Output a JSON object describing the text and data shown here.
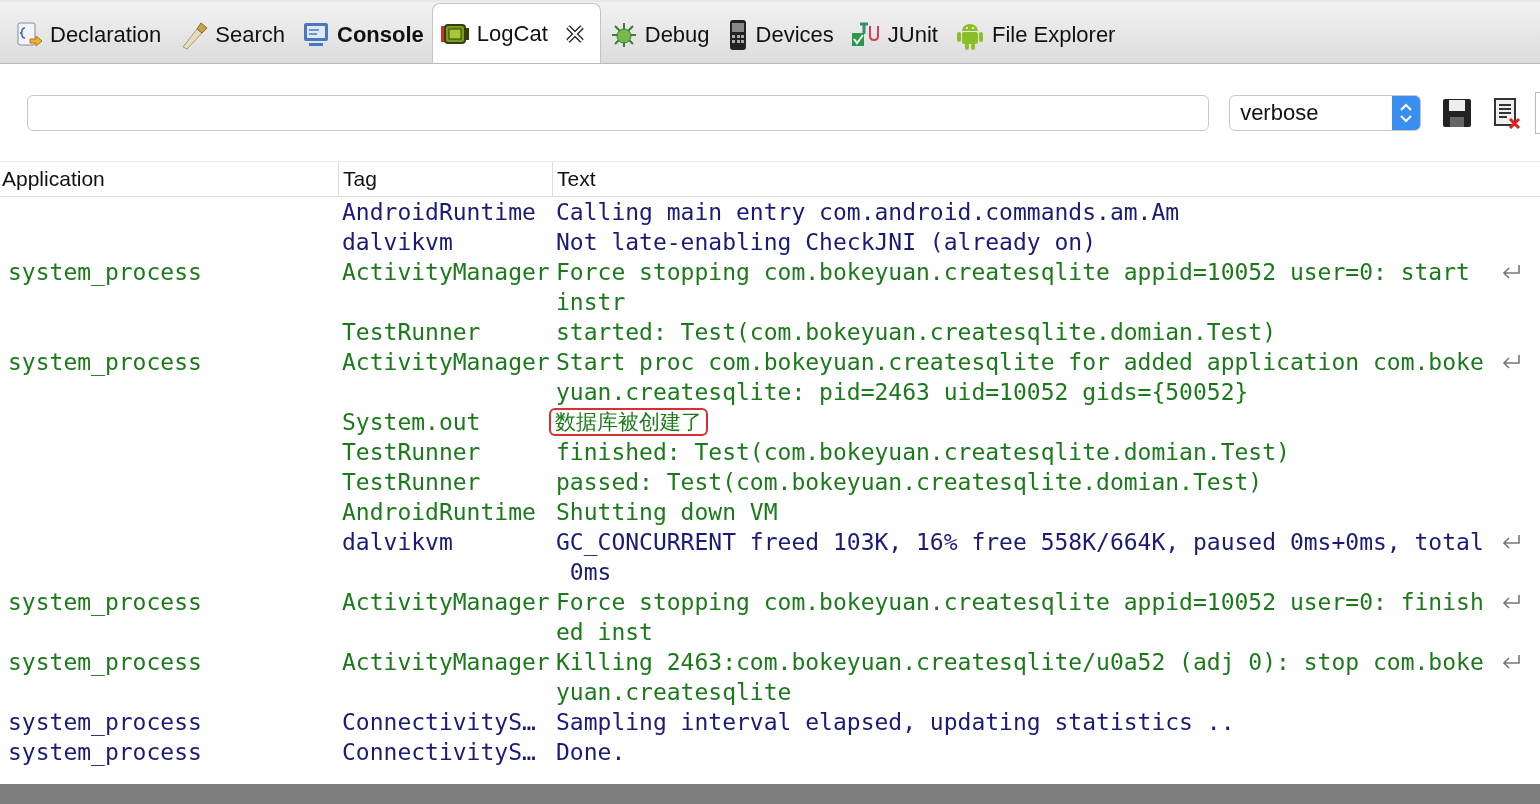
{
  "tabs": [
    {
      "label": "Declaration",
      "selected": false,
      "bold": false,
      "closable": false
    },
    {
      "label": "Search",
      "selected": false,
      "bold": false,
      "closable": false
    },
    {
      "label": "Console",
      "selected": false,
      "bold": true,
      "closable": false
    },
    {
      "label": "LogCat",
      "selected": true,
      "bold": false,
      "closable": true
    },
    {
      "label": "Debug",
      "selected": false,
      "bold": false,
      "closable": false
    },
    {
      "label": "Devices",
      "selected": false,
      "bold": false,
      "closable": false
    },
    {
      "label": "JUnit",
      "selected": false,
      "bold": false,
      "closable": false
    },
    {
      "label": "File Explorer",
      "selected": false,
      "bold": false,
      "closable": false
    }
  ],
  "filter": {
    "level_select": "verbose"
  },
  "table": {
    "columns": [
      "Application",
      "Tag",
      "Text"
    ],
    "rows": [
      {
        "kind": "debug",
        "application": "",
        "tag": "AndroidRuntime",
        "text": [
          "Calling main entry com.android.commands.am.Am"
        ]
      },
      {
        "kind": "debug",
        "application": "",
        "tag": "dalvikvm",
        "text": [
          "Not late-enabling CheckJNI (already on)"
        ]
      },
      {
        "kind": "info",
        "application": "system_process",
        "tag": "ActivityManager",
        "text": [
          "Force stopping com.bokeyuan.createsqlite appid=10052 user=0: start",
          "instr"
        ]
      },
      {
        "kind": "info",
        "application": "",
        "tag": "TestRunner",
        "text": [
          "started: Test(com.bokeyuan.createsqlite.domian.Test)"
        ]
      },
      {
        "kind": "info",
        "application": "system_process",
        "tag": "ActivityManager",
        "text": [
          "Start proc com.bokeyuan.createsqlite for added application com.boke",
          "yuan.createsqlite: pid=2463 uid=10052 gids={50052}"
        ]
      },
      {
        "kind": "info",
        "application": "",
        "tag": "System.out",
        "text": [
          "数据库被创建了"
        ],
        "highlighted": true
      },
      {
        "kind": "info",
        "application": "",
        "tag": "TestRunner",
        "text": [
          "finished: Test(com.bokeyuan.createsqlite.domian.Test)"
        ]
      },
      {
        "kind": "info",
        "application": "",
        "tag": "TestRunner",
        "text": [
          "passed: Test(com.bokeyuan.createsqlite.domian.Test)"
        ]
      },
      {
        "kind": "info",
        "application": "",
        "tag": "AndroidRuntime",
        "text": [
          "Shutting down VM"
        ]
      },
      {
        "kind": "debug",
        "application": "",
        "tag": "dalvikvm",
        "text": [
          "GC_CONCURRENT freed 103K, 16% free 558K/664K, paused 0ms+0ms, total",
          " 0ms"
        ]
      },
      {
        "kind": "info",
        "application": "system_process",
        "tag": "ActivityManager",
        "text": [
          "Force stopping com.bokeyuan.createsqlite appid=10052 user=0: finish",
          "ed inst"
        ]
      },
      {
        "kind": "info",
        "application": "system_process",
        "tag": "ActivityManager",
        "text": [
          "Killing 2463:com.bokeyuan.createsqlite/u0a52 (adj 0): stop com.boke",
          "yuan.createsqlite"
        ]
      },
      {
        "kind": "debug",
        "application": "system_process",
        "tag": "ConnectivityS…",
        "text": [
          "Sampling interval elapsed, updating statistics .."
        ]
      },
      {
        "kind": "debug",
        "application": "system_process",
        "tag": "ConnectivityS…",
        "text": [
          "Done."
        ]
      }
    ]
  }
}
